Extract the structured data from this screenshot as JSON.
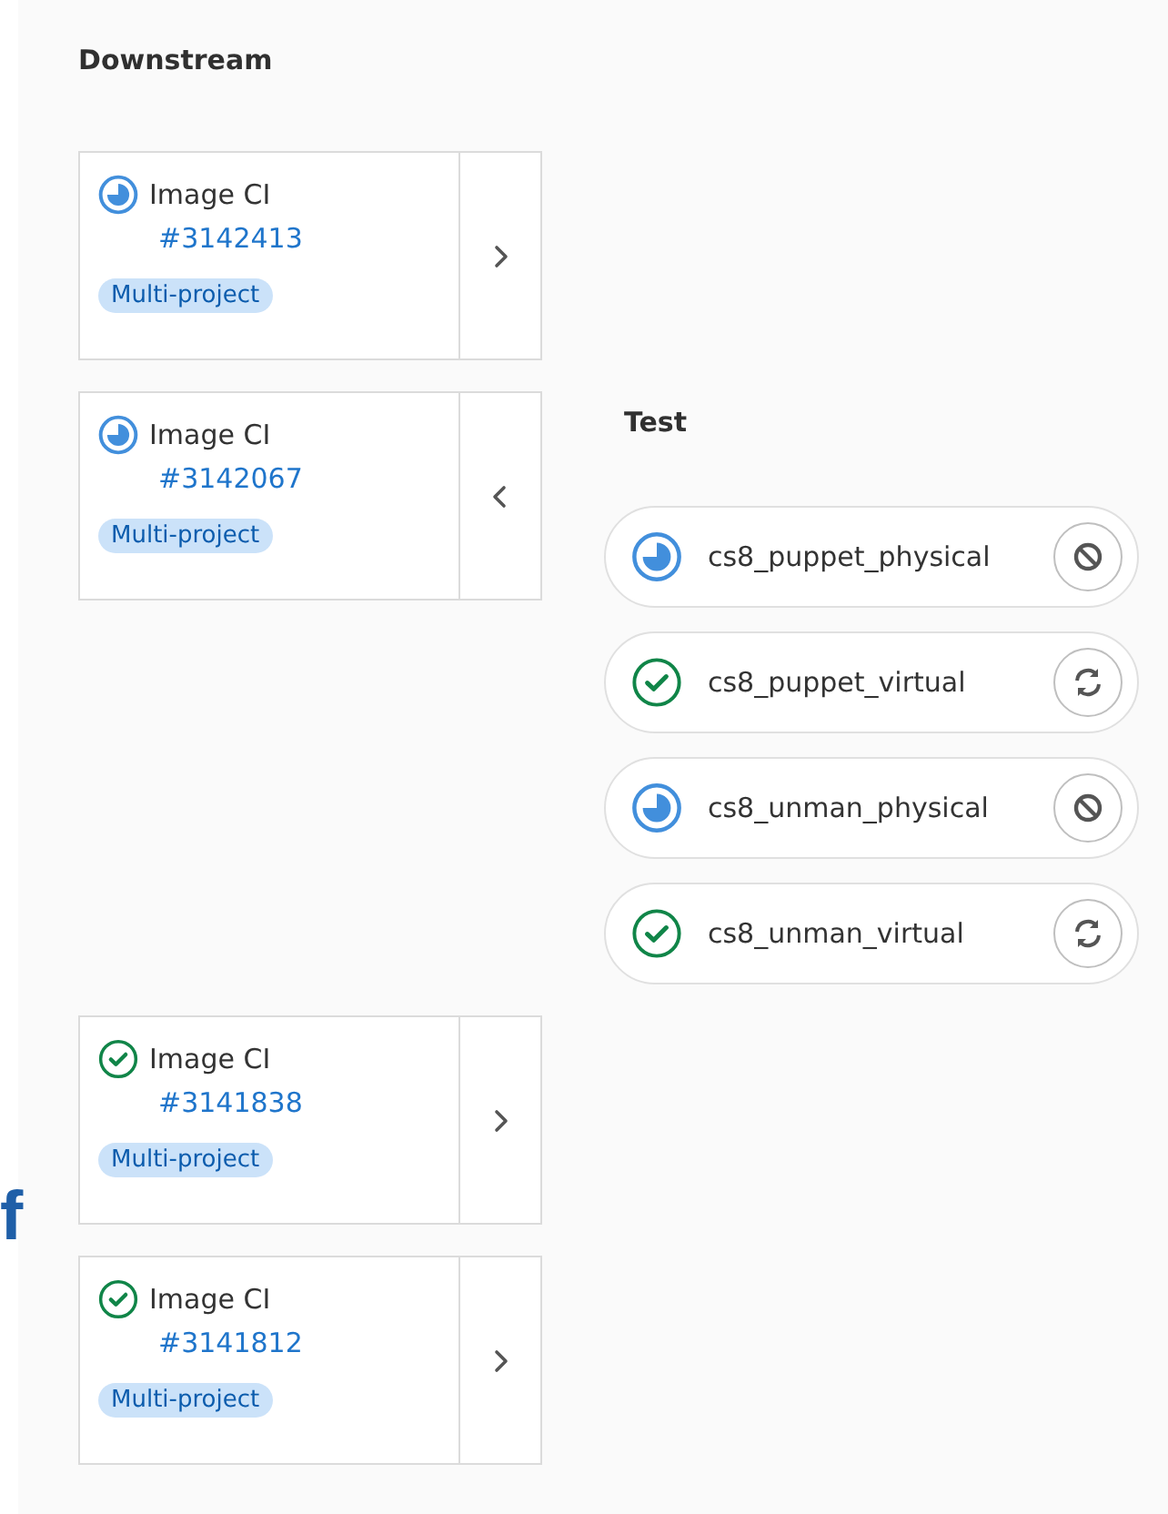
{
  "edge_text": "f",
  "downstream": {
    "title": "Downstream",
    "pipelines": [
      {
        "project": "Image CI",
        "id": "#3142413",
        "passed": false,
        "badge": "Multi-project",
        "expanded": false
      },
      {
        "project": "Image CI",
        "id": "#3142067",
        "passed": false,
        "badge": "Multi-project",
        "expanded": true
      },
      {
        "project": "Image CI",
        "id": "#3141838",
        "passed": true,
        "badge": "Multi-project",
        "expanded": false
      },
      {
        "project": "Image CI",
        "id": "#3141812",
        "passed": true,
        "badge": "Multi-project",
        "expanded": false
      }
    ]
  },
  "stage": {
    "title": "Test",
    "jobs": [
      {
        "name": "cs8_puppet_physical",
        "passed": false
      },
      {
        "name": "cs8_puppet_virtual",
        "passed": true
      },
      {
        "name": "cs8_unman_physical",
        "passed": false
      },
      {
        "name": "cs8_unman_virtual",
        "passed": true
      }
    ]
  }
}
